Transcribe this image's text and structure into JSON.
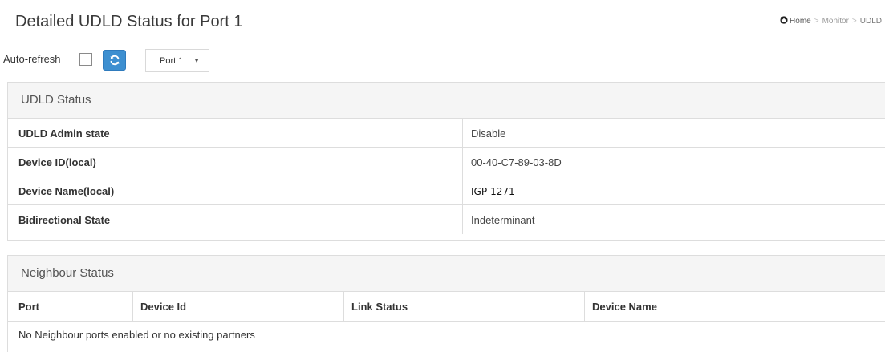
{
  "header": {
    "title": "Detailed UDLD Status for  Port 1",
    "breadcrumb": {
      "home": "Home",
      "separator": ">",
      "items": [
        "Monitor",
        "UDLD"
      ]
    }
  },
  "controls": {
    "auto_refresh_label": "Auto-refresh",
    "auto_refresh_checked": false,
    "refresh_icon": "refresh-icon",
    "port_select": {
      "value": "Port 1",
      "arrow": "▼"
    },
    "accent_color": "#3d8fd0"
  },
  "udld_status": {
    "title": "UDLD Status",
    "rows": [
      {
        "key": "UDLD Admin state",
        "value": "Disable"
      },
      {
        "key": "Device ID(local)",
        "value": "00-40-C7-89-03-8D"
      },
      {
        "key": "Device Name(local)",
        "value": "IGP-1271"
      },
      {
        "key": "Bidirectional State",
        "value": "Indeterminant"
      }
    ]
  },
  "neighbour_status": {
    "title": "Neighbour Status",
    "columns": [
      "Port",
      "Device Id",
      "Link Status",
      "Device Name"
    ],
    "empty_message": "No Neighbour ports enabled or no existing partners"
  }
}
